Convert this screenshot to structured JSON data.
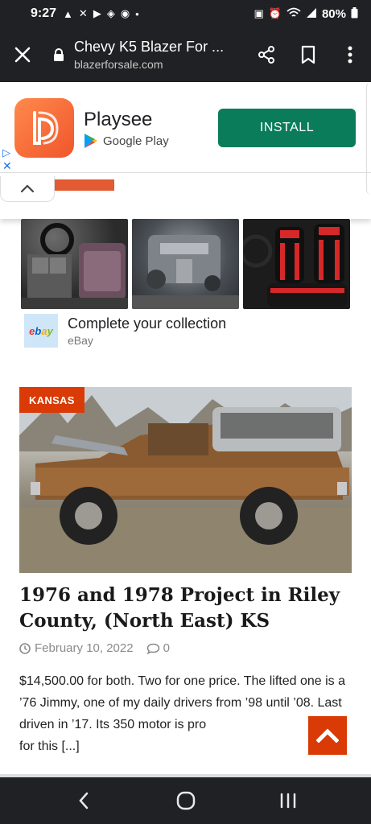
{
  "status_bar": {
    "time": "9:27",
    "battery": "80%"
  },
  "toolbar": {
    "page_title": "Chevy K5 Blazer For ...",
    "domain": "blazerforsale.com"
  },
  "ad": {
    "app_name": "Playsee",
    "store": "Google Play",
    "install_label": "INSTALL",
    "install_color": "#0b7c59"
  },
  "ebay_ad": {
    "logo_letters": [
      "e",
      "b",
      "a",
      "y"
    ],
    "title": "Complete your collection",
    "source": "eBay"
  },
  "article": {
    "category": "KANSAS",
    "title": "1976 and 1978 Project in Riley County, (North East) KS",
    "date": "February 10, 2022",
    "comments": "0",
    "excerpt": "$14,500.00 for both. Two for one price. The lifted one is a ’76 Jimmy, one of my daily drivers from ’98 until ’08. Last driven in ’17. Its 350 motor is pro",
    "excerpt_end": "for this [...]",
    "accent_color": "#d93a06"
  },
  "icons": [
    "close-icon",
    "lock-icon",
    "share-icon",
    "bookmark-icon",
    "more-vert-icon",
    "chevron-up-icon",
    "clock-icon",
    "comment-icon",
    "back-icon",
    "home-icon",
    "recents-icon"
  ]
}
